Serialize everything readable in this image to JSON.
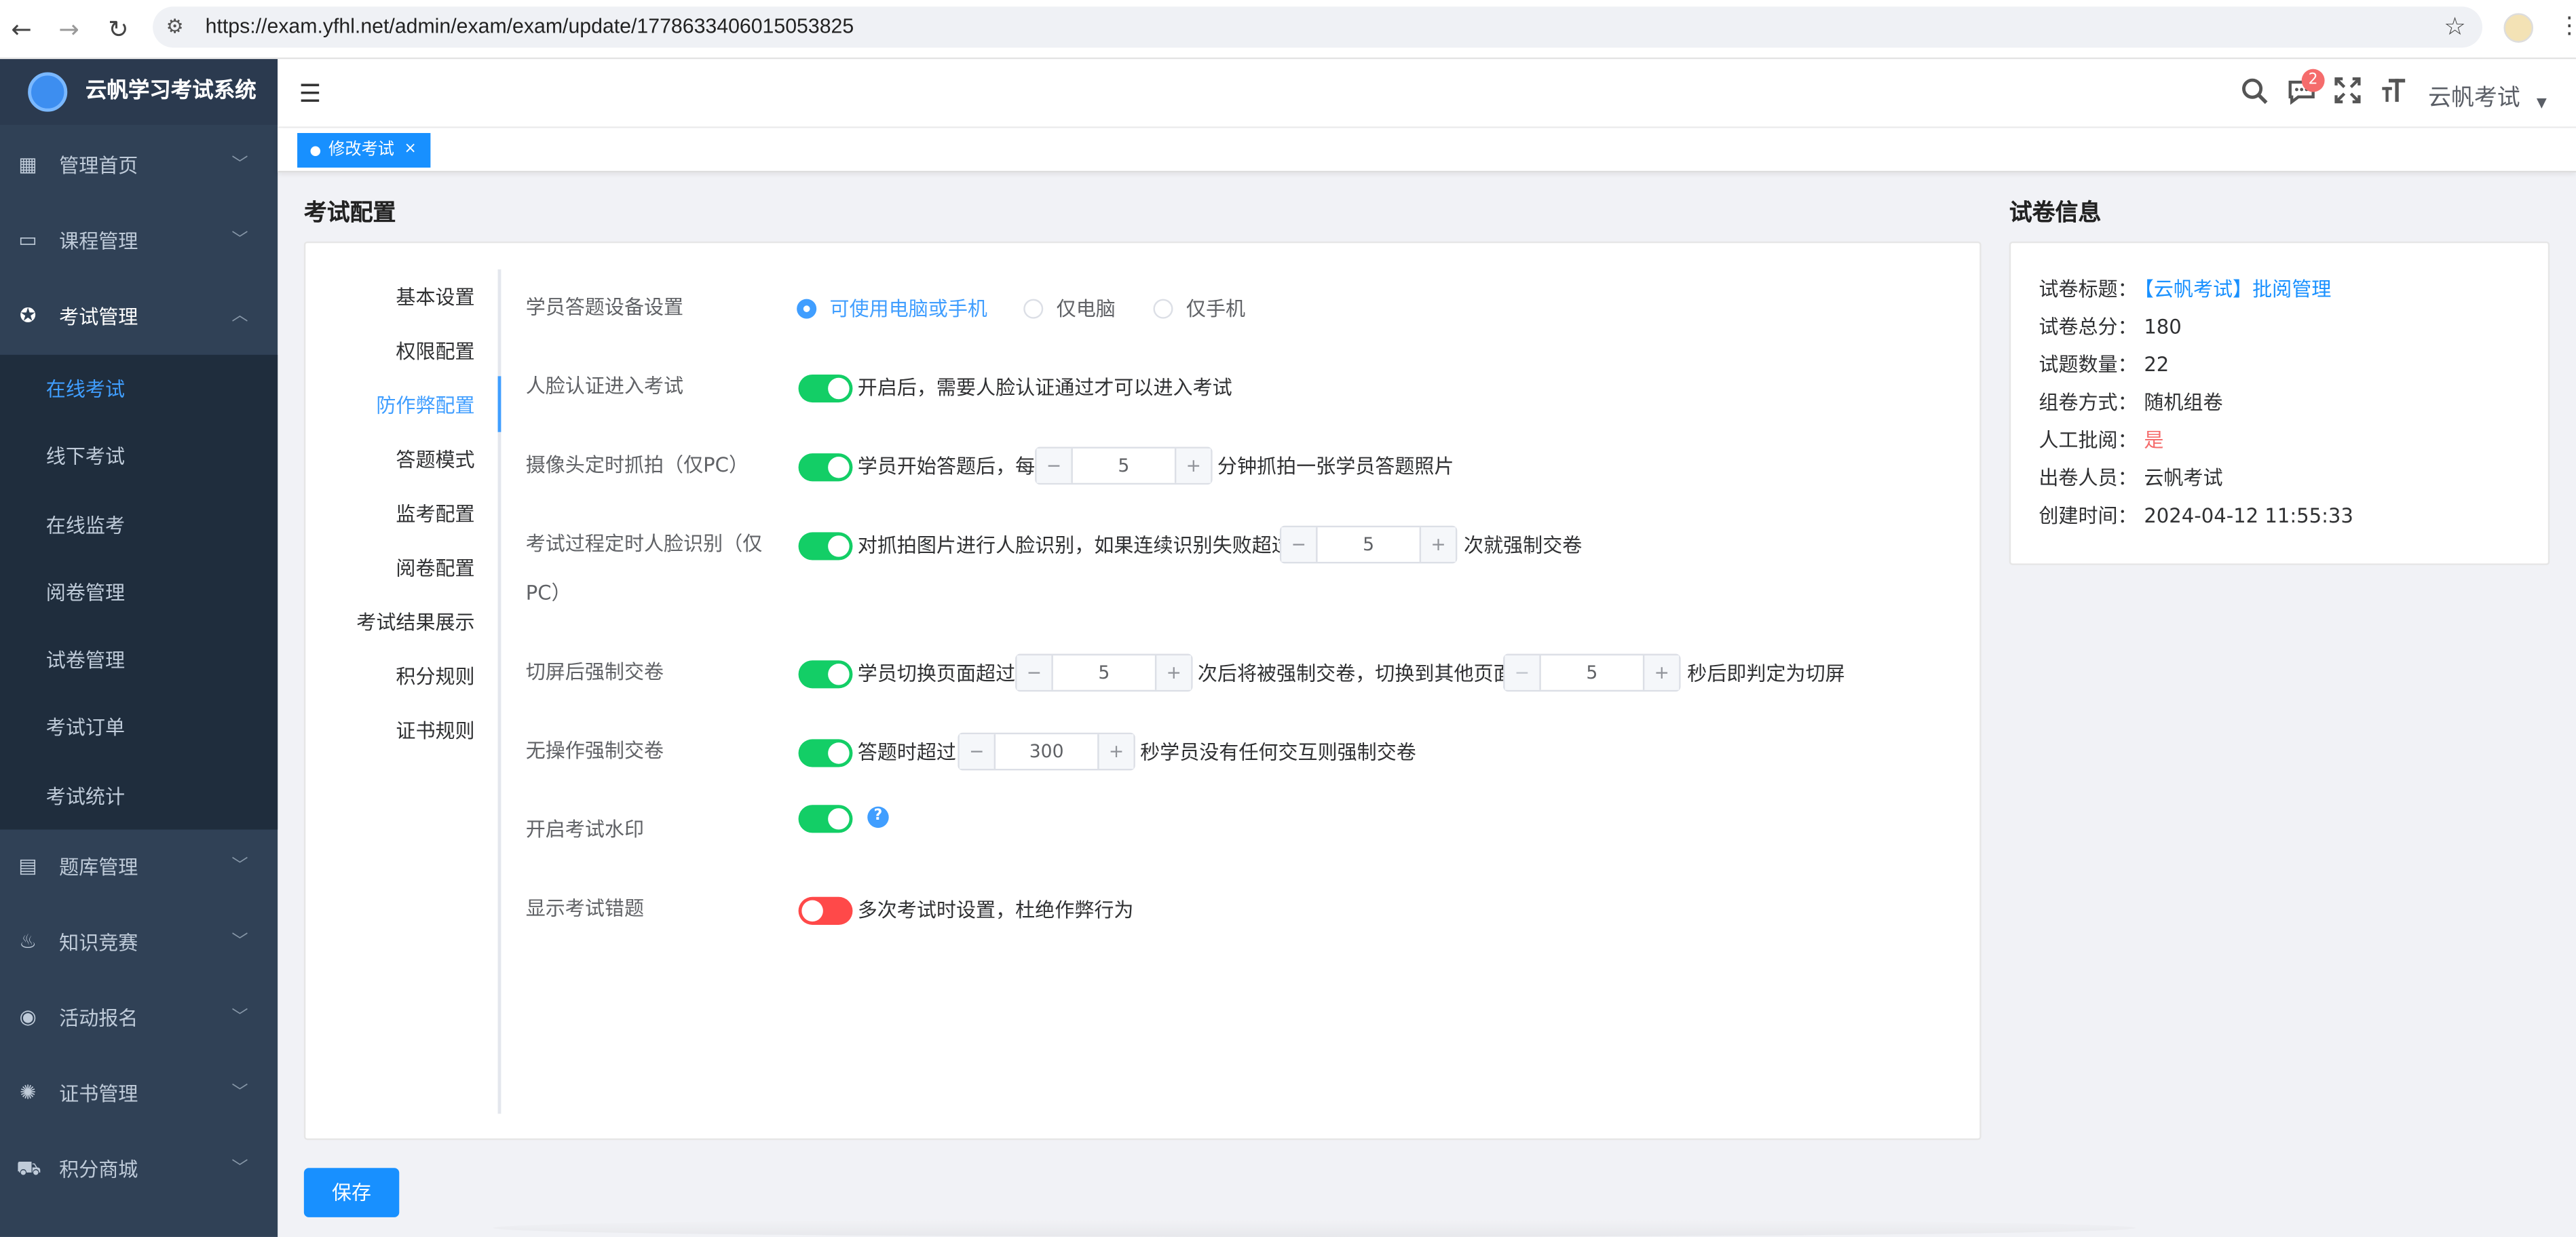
{
  "browser": {
    "url": "https://exam.yfhl.net/admin/exam/exam/update/1778633406015053825",
    "back": "←",
    "forward": "→",
    "reload": "↻",
    "site_settings": "⚙",
    "bookmark": "☆",
    "menu": "⋮"
  },
  "sidebar": {
    "brand": "云帆学习考试系统",
    "menu1": {
      "label": "管理首页",
      "icon": "dashboard-icon"
    },
    "menu2": {
      "label": "课程管理",
      "icon": "monitor-icon"
    },
    "menu3": {
      "label": "考试管理",
      "icon": "exam-icon",
      "expanded": true
    },
    "sub": [
      {
        "label": "在线考试",
        "active": true
      },
      {
        "label": "线下考试"
      },
      {
        "label": "在线监考"
      },
      {
        "label": "阅卷管理"
      },
      {
        "label": "试卷管理"
      },
      {
        "label": "考试订单"
      },
      {
        "label": "考试统计"
      }
    ],
    "menu4": {
      "label": "题库管理",
      "icon": "document-icon"
    },
    "menu5": {
      "label": "知识竞赛",
      "icon": "fire-icon"
    },
    "menu6": {
      "label": "活动报名",
      "icon": "record-icon"
    },
    "menu7": {
      "label": "证书管理",
      "icon": "badge-icon"
    },
    "menu8": {
      "label": "积分商城",
      "icon": "cart-icon"
    },
    "arrow_down": "﹀",
    "arrow_up": "︿"
  },
  "navbar": {
    "hamburger": "☰",
    "notification_count": "2",
    "user_name": "云帆考试",
    "caret": "▼"
  },
  "tags": {
    "active_tag": "修改考试",
    "close": "×"
  },
  "exam_config": {
    "title": "考试配置",
    "tabs": [
      "基本设置",
      "权限配置",
      "防作弊配置",
      "答题模式",
      "监考配置",
      "阅卷配置",
      "考试结果展示",
      "积分规则",
      "证书规则"
    ],
    "active_tab": "防作弊配置",
    "device": {
      "label": "学员答题设备设置",
      "options": [
        "可使用电脑或手机",
        "仅电脑",
        "仅手机"
      ],
      "selected": "可使用电脑或手机"
    },
    "face_entry": {
      "label": "人脸认证进入考试",
      "enabled": true,
      "desc": "开启后，需要人脸认证通过才可以进入考试"
    },
    "camera": {
      "label": "摄像头定时抓拍（仅PC）",
      "enabled": true,
      "pre": "学员开始答题后，每",
      "value": "5",
      "post": "分钟抓拍一张学员答题照片"
    },
    "face_rec": {
      "label_line1": "考试过程定时人脸识别（仅",
      "label_line2": "PC）",
      "enabled": true,
      "pre": "对抓拍图片进行人脸识别，如果连续识别失败超过",
      "value": "5",
      "post": "次就强制交卷"
    },
    "switch_screen": {
      "label": "切屏后强制交卷",
      "enabled": true,
      "pre": "学员切换页面超过",
      "value1": "5",
      "mid": "次后将被强制交卷，切换到其他页面",
      "value2": "5",
      "post": "秒后即判定为切屏"
    },
    "idle": {
      "label": "无操作强制交卷",
      "enabled": true,
      "pre": "答题时超过",
      "value": "300",
      "post": "秒学员没有任何交互则强制交卷"
    },
    "watermark": {
      "label": "开启考试水印",
      "enabled": true,
      "help": "?"
    },
    "show_wrong": {
      "label": "显示考试错题",
      "enabled": false,
      "desc": "多次考试时设置，杜绝作弊行为"
    },
    "stepper_minus": "−",
    "stepper_plus": "+"
  },
  "save_button": "保存",
  "paper_info": {
    "title": "试卷信息",
    "rows": [
      {
        "key": "试卷标题：",
        "value": "【云帆考试】批阅管理"
      },
      {
        "key": "试卷总分：",
        "value": "180"
      },
      {
        "key": "试题数量：",
        "value": "22"
      },
      {
        "key": "组卷方式：",
        "value": "随机组卷"
      },
      {
        "key": "人工批阅：",
        "value": "是"
      },
      {
        "key": "出卷人员：",
        "value": "云帆考试"
      },
      {
        "key": "创建时间：",
        "value": "2024-04-12 11:55:33"
      }
    ]
  },
  "colors": {
    "primary": "#1890ff",
    "sidebar": "#304156",
    "switch_on": "#13ce66",
    "switch_off": "#ff4949"
  }
}
